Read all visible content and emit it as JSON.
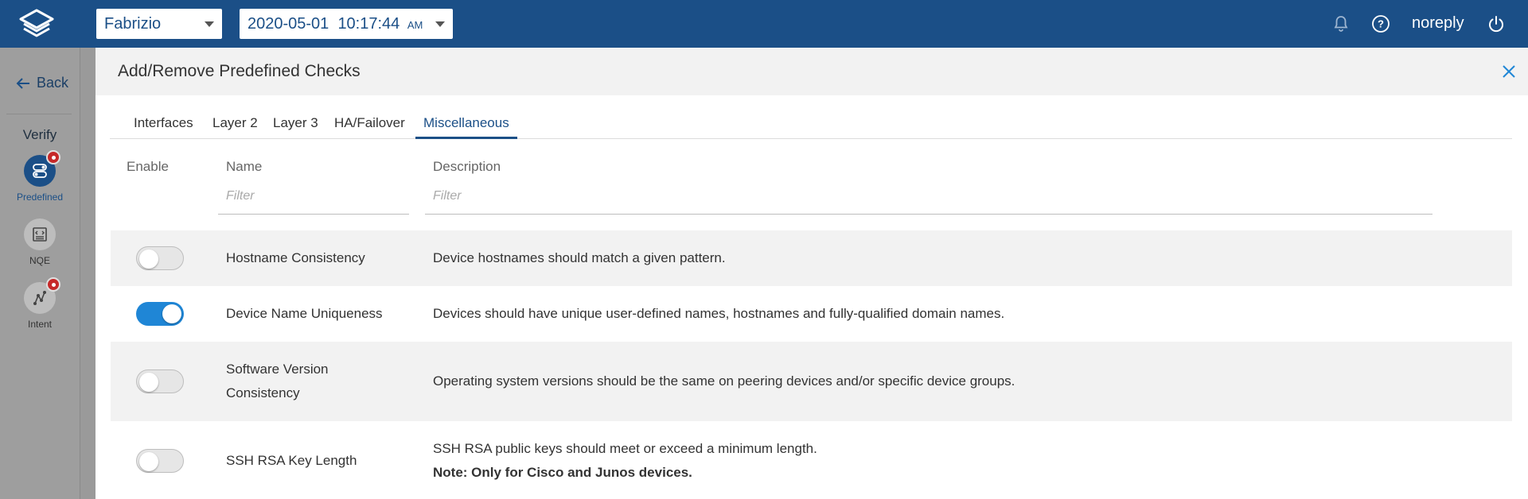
{
  "topbar": {
    "network": "Fabrizio",
    "snapshot_date": "2020-05-01",
    "snapshot_time": "10:17:44",
    "snapshot_ampm": "AM",
    "user": "noreply"
  },
  "rail": {
    "back_label": "Back",
    "section_label": "Verify",
    "items": [
      {
        "label": "Predefined"
      },
      {
        "label": "NQE"
      },
      {
        "label": "Intent"
      }
    ]
  },
  "modal": {
    "title": "Add/Remove Predefined Checks",
    "tabs": [
      "Interfaces",
      "Layer 2",
      "Layer 3",
      "HA/Failover",
      "Miscellaneous"
    ],
    "active_tab": "Miscellaneous",
    "columns": {
      "enable": "Enable",
      "name": "Name",
      "description": "Description"
    },
    "filter_placeholder": "Filter",
    "rows": [
      {
        "name": "Hostname Consistency",
        "enabled": false,
        "description": "Device hostnames should match a given pattern."
      },
      {
        "name": "Device Name Uniqueness",
        "enabled": true,
        "description": "Devices should have unique user-defined names, hostnames and fully-qualified domain names."
      },
      {
        "name_line1": "Software Version",
        "name_line2": "Consistency",
        "enabled": false,
        "description": "Operating system versions should be the same on peering devices and/or specific device groups."
      },
      {
        "name": "SSH RSA Key Length",
        "enabled": false,
        "description": "SSH RSA public keys should meet or exceed a minimum length.",
        "note": "Note: Only for Cisco and Junos devices."
      }
    ]
  },
  "colors": {
    "brand": "#1b4f87",
    "toggle_on": "#1f86d6",
    "badge": "#c62828"
  }
}
